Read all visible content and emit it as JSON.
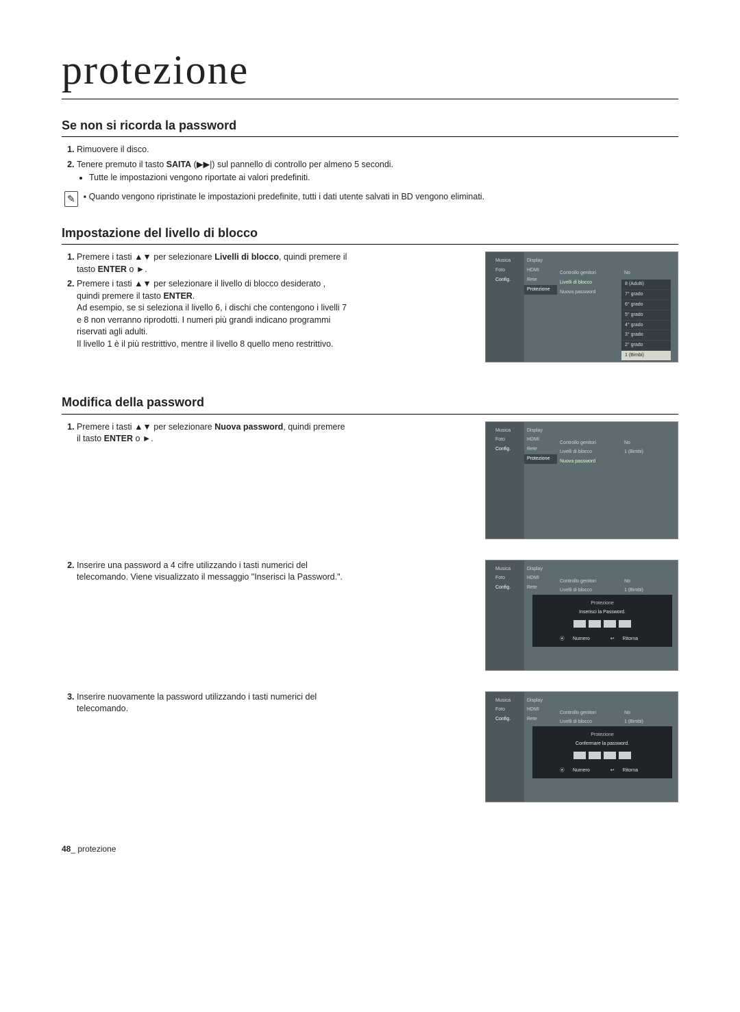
{
  "page_title": "protezione",
  "sections": {
    "forgot": {
      "heading": "Se non si ricorda la password",
      "step1": "Rimuovere il disco.",
      "step2_pre": "Tenere premuto il tasto ",
      "step2_b": "SAITA",
      "step2_post": " (▶▶|) sul pannello di controllo per almeno 5 secondi.",
      "bullet1": "Tutte le impostazioni vengono riportate ai valori predefiniti.",
      "note": "Quando vengono ripristinate le impostazioni predefinite, tutti i dati utente salvati in BD vengono eliminati."
    },
    "lock": {
      "heading": "Impostazione del livello di blocco",
      "s1a": "Premere i tasti ",
      "s1b": " per selezionare ",
      "s1bold": "Livelli di blocco",
      "s1c": ", quindi premere il tasto ",
      "s1d": "ENTER",
      "s1e": " o ►.",
      "s2a": "Premere i tasti ",
      "s2b": " per selezionare il livello di blocco desiderato , quindi premere il tasto ",
      "s2bold": "ENTER",
      "s2dot": ".",
      "s2c": "Ad esempio, se si seleziona il livello 6, i dischi che contengono i livelli 7 e 8 non verranno riprodotti. I numeri più grandi indicano programmi riservati agli adulti.",
      "s2d": "Il livello 1 è il più restrittivo, mentre il livello 8 quello meno restrittivo."
    },
    "pwd": {
      "heading": "Modifica della password",
      "s1a": "Premere i tasti ",
      "s1b": " per selezionare ",
      "s1bold": "Nuova password",
      "s1c": ", quindi premere il tasto ",
      "s1d": "ENTER",
      "s1e": " o ►.",
      "s2": "Inserire una password a 4 cifre utilizzando i tasti numerici del telecomando. Viene visualizzato il messaggio \"Inserisci la Password.\".",
      "s3": "Inserire nuovamente la password utilizzando i tasti numerici del telecomando."
    }
  },
  "arrows_ud": "▲▼",
  "screenshots": {
    "sidebar": {
      "music": "Musica",
      "foto": "Foto",
      "config": "Config."
    },
    "col2": {
      "display": "Display",
      "hdmi": "HDMI",
      "rete": "Rete",
      "protezione": "Protezione"
    },
    "col3": {
      "cg": "Controllo genitori",
      "ldb": "Livelli di blocco",
      "np": "Nuova password"
    },
    "vals": {
      "no": "No",
      "one_bimbi": "1 (Bimbi)"
    },
    "dropdown": [
      "8 (Adulti)",
      "7° grado",
      "6° grado",
      "5° grado",
      "4° grado",
      "3° grado",
      "2° grado",
      "1 (Bimbi)"
    ],
    "overlay": {
      "title": "Protezione",
      "enter": "Inserisci la Password.",
      "confirm": "Confermare la password.",
      "numero": "Numero",
      "ritorna": "Ritorna"
    }
  },
  "footer": {
    "page": "48",
    "label": "_ protezione"
  }
}
